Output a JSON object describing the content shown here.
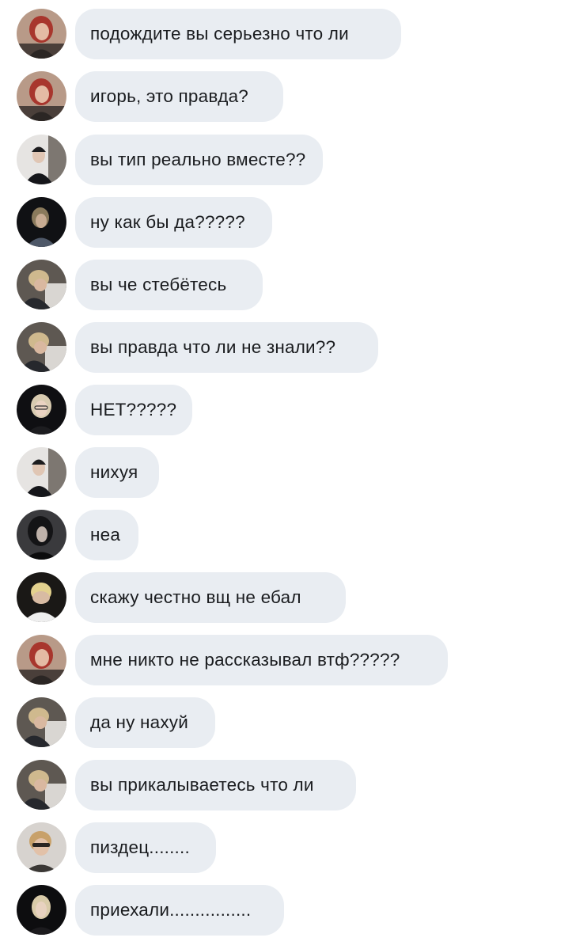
{
  "chat": {
    "messages": [
      {
        "avatar": "avatar-red-hair-woman",
        "text": "подождите вы серьезно что ли"
      },
      {
        "avatar": "avatar-red-hair-woman",
        "text": "игорь, это правда?"
      },
      {
        "avatar": "avatar-beanie-boy",
        "text": "вы тип реально вместе??"
      },
      {
        "avatar": "avatar-dark-boy",
        "text": "ну как бы да?????"
      },
      {
        "avatar": "avatar-blond-boy-leaning",
        "text": "вы че стебётесь"
      },
      {
        "avatar": "avatar-blond-boy-leaning",
        "text": "вы правда что ли не знали??"
      },
      {
        "avatar": "avatar-blonde-girl-glasses",
        "text": "НЕТ?????"
      },
      {
        "avatar": "avatar-beanie-boy",
        "text": "нихуя"
      },
      {
        "avatar": "avatar-dark-hair-girl",
        "text": "неа"
      },
      {
        "avatar": "avatar-hands-on-face",
        "text": "скажу честно вщ не ебал"
      },
      {
        "avatar": "avatar-red-hair-woman",
        "text": "мне никто не рассказывал втф?????"
      },
      {
        "avatar": "avatar-blond-boy-leaning",
        "text": "да ну нахуй"
      },
      {
        "avatar": "avatar-blond-boy-leaning",
        "text": "вы прикалываетесь что ли"
      },
      {
        "avatar": "avatar-sunglasses-guy",
        "text": "пиздец........"
      },
      {
        "avatar": "avatar-blonde-girl-dark",
        "text": "приехали................"
      }
    ]
  },
  "colors": {
    "bubble_bg": "#e9edf2",
    "text": "#1a1c1f",
    "background": "#ffffff"
  }
}
